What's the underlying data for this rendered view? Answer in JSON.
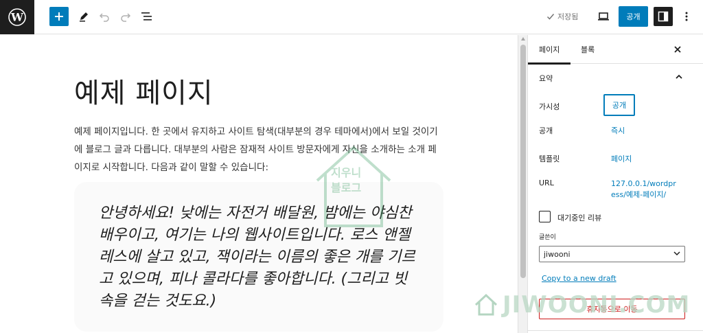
{
  "topbar": {
    "saved_label": "저장됨",
    "publish_label": "공개"
  },
  "editor": {
    "title": "예제 페이지",
    "paragraph": "예제 페이지입니다. 한 곳에서 유지하고 사이트 탐색(대부분의 경우 테마에서)에서 보일 것이기에 블로그 글과 다릅니다. 대부분의 사람은 잠재적 사이트 방문자에게 자신을 소개하는 소개 페이지로 시작합니다. 다음과 같이 말할 수 있습니다:",
    "quote": "안녕하세요! 낮에는 자전거 배달원, 밤에는 야심찬 배우이고, 여기는 나의 웹사이트입니다. 로스 앤젤레스에 살고 있고, 잭이라는 이름의 좋은 개를 기르고 있으며, 피나 콜라다를 좋아합니다. (그리고 빗 속을 걷는 것도요.)"
  },
  "watermark": {
    "line1": "지우니",
    "line2": "블로그",
    "brand": "JIWOONI.COM"
  },
  "sidebar": {
    "tabs": [
      {
        "label": "페이지",
        "active": true
      },
      {
        "label": "블록",
        "active": false
      }
    ],
    "summary_label": "요약",
    "rows": [
      {
        "label": "가시성",
        "value": "공개"
      },
      {
        "label": "공개",
        "value": "즉시"
      },
      {
        "label": "템플릿",
        "value": "페이지"
      },
      {
        "label": "URL",
        "value": "127.0.0.1/wordpress/예제-페이지/"
      }
    ],
    "pending_review_label": "대기중인 리뷰",
    "author_label": "글쓴이",
    "author_value": "jiwooni",
    "copy_draft_label": "Copy to a new draft",
    "trash_label": "휴지통으로 이동"
  },
  "colors": {
    "accent": "#007cba",
    "danger": "#cc1818",
    "dark": "#1e1e1e"
  }
}
